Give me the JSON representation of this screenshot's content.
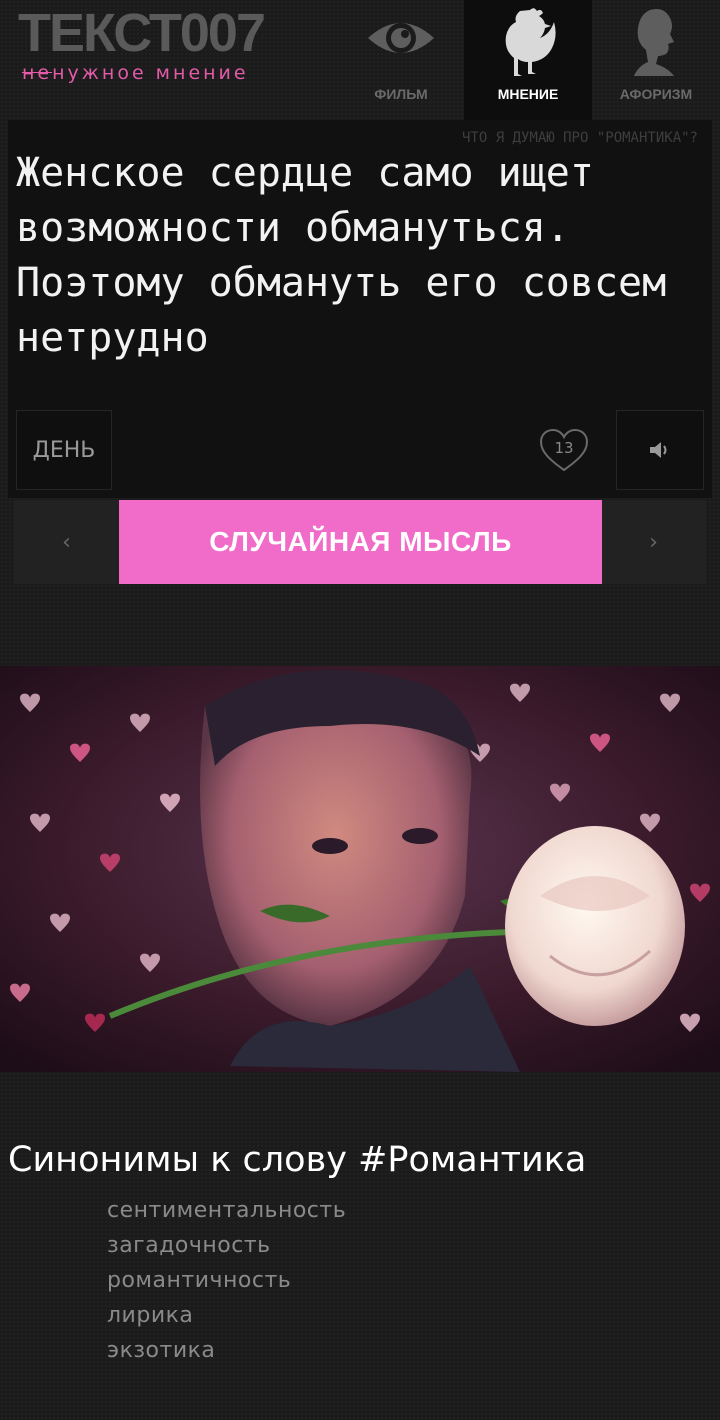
{
  "logo": {
    "title": "ТЕКСТ007",
    "subtitle_strike": "не",
    "subtitle_rest": "нужное мнение"
  },
  "nav": [
    {
      "label": "ФИЛЬМ",
      "icon": "eye-icon",
      "active": false
    },
    {
      "label": "МНЕНИЕ",
      "icon": "chicken-icon",
      "active": true
    },
    {
      "label": "АФОРИЗМ",
      "icon": "head-silhouette-icon",
      "active": false
    }
  ],
  "panel": {
    "caption": "ЧТО Я ДУМАЮ ПРО \"РОМАНТИКА\"?",
    "quote": "Женское сердце само ищет возможности обмануться. Поэтому обмануть его совсем нетрудно",
    "day_label": "ДЕНЬ",
    "likes": "13"
  },
  "random": {
    "label": "СЛУЧАЙНАЯ МЫСЛЬ",
    "prev": "‹",
    "next": "›"
  },
  "synonyms": {
    "title": "Синонимы к слову #Романтика",
    "items": [
      "сентиментальность",
      "загадочность",
      "романтичность",
      "лирика",
      "экзотика"
    ]
  },
  "colors": {
    "accent": "#f06cc8",
    "logo_sub": "#e25aa8",
    "background": "#1b1b1b",
    "panel": "#111111"
  }
}
